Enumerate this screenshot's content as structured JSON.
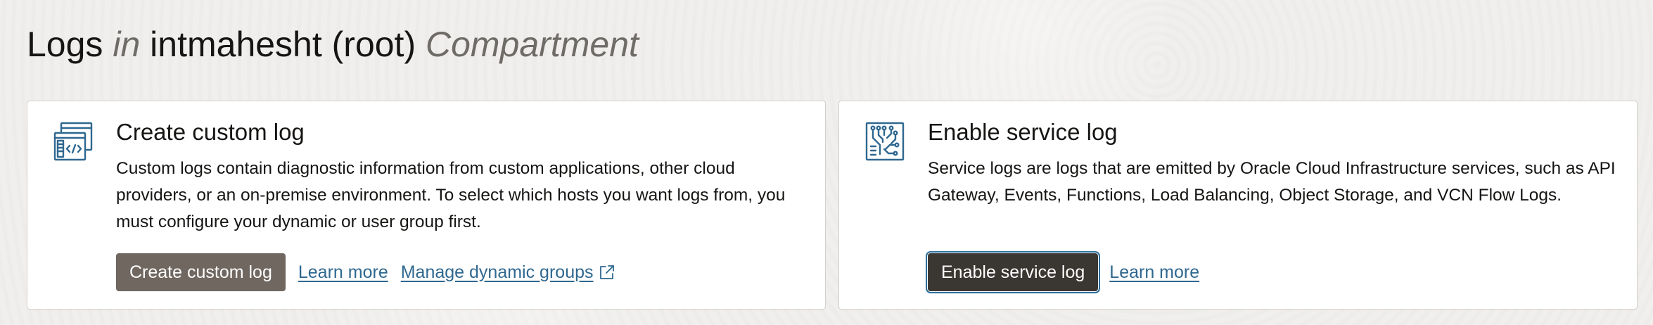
{
  "page": {
    "title_part1": "Logs",
    "title_part2": "in",
    "title_part3": "intmahesht (root)",
    "title_part4": "Compartment"
  },
  "cards": [
    {
      "icon": "code-window-icon",
      "title": "Create custom log",
      "description": "Custom logs contain diagnostic information from custom applications, other cloud providers, or an on-premise environment. To select which hosts you want logs from, you must configure your dynamic or user group first.",
      "button_label": "Create custom log",
      "links": [
        "Learn more",
        "Manage dynamic groups"
      ],
      "external_link_icon": "external-link-icon"
    },
    {
      "icon": "circuit-board-icon",
      "title": "Enable service log",
      "description": "Service logs are logs that are emitted by Oracle Cloud Infrastructure services, such as API Gateway, Events, Functions, Load Balancing, Object Storage, and VCN Flow Logs.",
      "button_label": "Enable service log",
      "links": [
        "Learn more"
      ]
    }
  ],
  "colors": {
    "background": "#f1efed",
    "icon": "#2f6890",
    "link": "#2f6890",
    "button_primary": "#6f6760",
    "button_focused": "#3a3631",
    "focus_ring": "#2b6f9e"
  }
}
